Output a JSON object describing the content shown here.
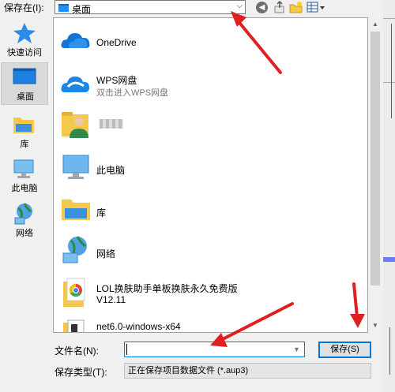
{
  "toolbar": {
    "save_in_label": "保存在(I):",
    "location_value": "桌面",
    "back_glyph": "◀"
  },
  "places": [
    {
      "label": "快速访问",
      "icon": "star-icon",
      "selected": false
    },
    {
      "label": "桌面",
      "icon": "desktop-icon",
      "selected": true
    },
    {
      "label": "库",
      "icon": "library-folder-icon",
      "selected": false
    },
    {
      "label": "此电脑",
      "icon": "computer-icon",
      "selected": false
    },
    {
      "label": "网络",
      "icon": "network-icon",
      "selected": false
    }
  ],
  "files": [
    {
      "name": "OneDrive",
      "sub": "",
      "icon": "onedrive-cloud-icon"
    },
    {
      "name": "WPS网盘",
      "sub": "双击进入WPS网盘",
      "icon": "wps-cloud-icon"
    },
    {
      "name": "",
      "sub": "",
      "icon": "user-folder-icon"
    },
    {
      "name": "此电脑",
      "sub": "",
      "icon": "computer-icon"
    },
    {
      "name": "库",
      "sub": "",
      "icon": "library-folder-icon"
    },
    {
      "name": "网络",
      "sub": "",
      "icon": "network-icon"
    },
    {
      "name": "LOL换肤助手单板换肤永久免费版",
      "sub": "V12.11",
      "icon": "chrome-folder-icon"
    },
    {
      "name": "net6.0-windows-x64",
      "sub": "",
      "icon": "folder-icon"
    }
  ],
  "bottom": {
    "filename_label": "文件名(N):",
    "filename_value": "",
    "save_button": "保存(S)",
    "filetype_label": "保存类型(T):",
    "filetype_value": "正在保存项目数据文件 (*.aup3)"
  },
  "colors": {
    "accent": "#0078d7",
    "arrow": "#e02020",
    "folder": "#f4c84a"
  }
}
